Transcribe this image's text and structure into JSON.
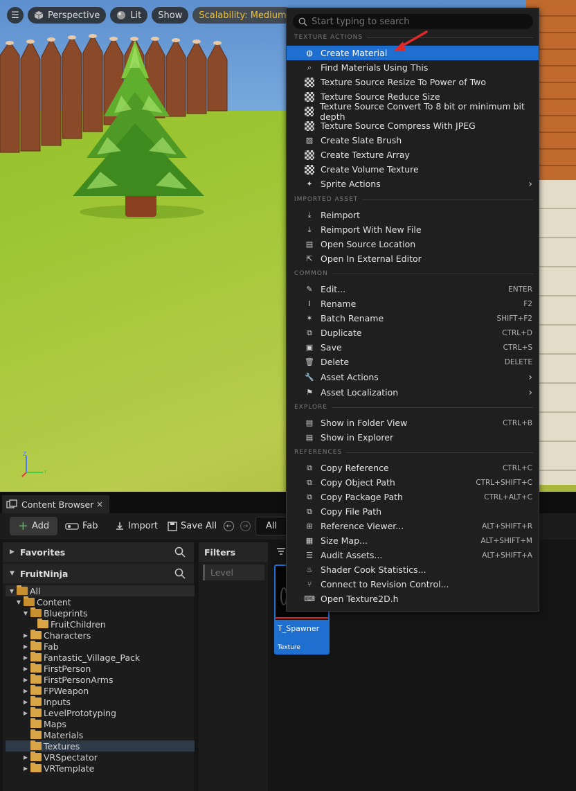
{
  "viewport": {
    "menu_icon": "hamburger-icon",
    "perspective_label": "Perspective",
    "lit_label": "Lit",
    "show_label": "Show",
    "scalability_label": "Scalability: Medium",
    "axis_labels": {
      "z": "Z",
      "x": "X",
      "y": "Y"
    }
  },
  "context_menu": {
    "search_placeholder": "Start typing to search",
    "sections": {
      "texture_actions": "TEXTURE ACTIONS",
      "imported_asset": "IMPORTED ASSET",
      "common": "COMMON",
      "explore": "EXPLORE",
      "references": "REFERENCES"
    },
    "items": [
      {
        "label": "Create Material",
        "icon": "material-icon",
        "highlighted": true
      },
      {
        "label": "Find Materials Using This",
        "icon": "find-icon"
      },
      {
        "label": "Texture Source Resize To Power of Two",
        "icon": "checker-icon"
      },
      {
        "label": "Texture Source Reduce Size",
        "icon": "checker-icon"
      },
      {
        "label": "Texture Source Convert To 8 bit or minimum bit depth",
        "icon": "checker-icon"
      },
      {
        "label": "Texture Source Compress With JPEG",
        "icon": "checker-icon"
      },
      {
        "label": "Create Slate Brush",
        "icon": "brush-icon"
      },
      {
        "label": "Create Texture Array",
        "icon": "checker-icon"
      },
      {
        "label": "Create Volume Texture",
        "icon": "checker-icon"
      },
      {
        "label": "Sprite Actions",
        "icon": "sprite-icon",
        "submenu": true
      },
      {
        "label": "Reimport",
        "icon": "reimport-icon"
      },
      {
        "label": "Reimport With New File",
        "icon": "reimport-icon"
      },
      {
        "label": "Open Source Location",
        "icon": "folder-open-icon"
      },
      {
        "label": "Open In External Editor",
        "icon": "external-icon"
      },
      {
        "label": "Edit...",
        "icon": "edit-icon",
        "shortcut": "ENTER"
      },
      {
        "label": "Rename",
        "icon": "rename-icon",
        "shortcut": "F2"
      },
      {
        "label": "Batch Rename",
        "icon": "batch-icon",
        "shortcut": "SHIFT+F2"
      },
      {
        "label": "Duplicate",
        "icon": "duplicate-icon",
        "shortcut": "CTRL+D"
      },
      {
        "label": "Save",
        "icon": "save-icon",
        "shortcut": "CTRL+S"
      },
      {
        "label": "Delete",
        "icon": "delete-icon",
        "shortcut": "DELETE"
      },
      {
        "label": "Asset Actions",
        "icon": "wrench-icon",
        "submenu": true
      },
      {
        "label": "Asset Localization",
        "icon": "flag-icon",
        "submenu": true
      },
      {
        "label": "Show in Folder View",
        "icon": "folder-search-icon",
        "shortcut": "CTRL+B"
      },
      {
        "label": "Show in Explorer",
        "icon": "folder-search-icon"
      },
      {
        "label": "Copy Reference",
        "icon": "copy-icon",
        "shortcut": "CTRL+C"
      },
      {
        "label": "Copy Object Path",
        "icon": "copy-icon",
        "shortcut": "CTRL+SHIFT+C"
      },
      {
        "label": "Copy Package Path",
        "icon": "copy-icon",
        "shortcut": "CTRL+ALT+C"
      },
      {
        "label": "Copy File Path",
        "icon": "copy-icon"
      },
      {
        "label": "Reference Viewer...",
        "icon": "reference-icon",
        "shortcut": "ALT+SHIFT+R"
      },
      {
        "label": "Size Map...",
        "icon": "sizemap-icon",
        "shortcut": "ALT+SHIFT+M"
      },
      {
        "label": "Audit Assets...",
        "icon": "audit-icon",
        "shortcut": "ALT+SHIFT+A"
      },
      {
        "label": "Shader Cook Statistics...",
        "icon": "shader-icon"
      },
      {
        "label": "Connect to Revision Control...",
        "icon": "revision-icon"
      },
      {
        "label": "Open Texture2D.h",
        "icon": "code-icon"
      }
    ]
  },
  "content_browser": {
    "tab_label": "Content Browser",
    "close_glyph": "×",
    "toolbar": {
      "add_label": "Add",
      "fab_label": "Fab",
      "import_label": "Import",
      "save_all_label": "Save All",
      "path_label": "All"
    },
    "favorites_label": "Favorites",
    "project_label": "FruitNinja",
    "filters_label": "Filters",
    "filter_level_label": "Level",
    "tree": [
      {
        "label": "All",
        "level": 0,
        "expanded": true,
        "open": true
      },
      {
        "label": "Content",
        "level": 1,
        "expanded": true,
        "open": true
      },
      {
        "label": "Blueprints",
        "level": 2,
        "expanded": true,
        "open": true
      },
      {
        "label": "FruitChildren",
        "level": 3
      },
      {
        "label": "Characters",
        "level": 2,
        "collapsed": true
      },
      {
        "label": "Fab",
        "level": 2,
        "collapsed": true
      },
      {
        "label": "Fantastic_Village_Pack",
        "level": 2,
        "collapsed": true
      },
      {
        "label": "FirstPerson",
        "level": 2,
        "collapsed": true
      },
      {
        "label": "FirstPersonArms",
        "level": 2,
        "collapsed": true
      },
      {
        "label": "FPWeapon",
        "level": 2,
        "collapsed": true
      },
      {
        "label": "Inputs",
        "level": 2,
        "collapsed": true
      },
      {
        "label": "LevelPrototyping",
        "level": 2,
        "collapsed": true
      },
      {
        "label": "Maps",
        "level": 2
      },
      {
        "label": "Materials",
        "level": 2
      },
      {
        "label": "Textures",
        "level": 2,
        "selected": true
      },
      {
        "label": "VRSpectator",
        "level": 2,
        "collapsed": true
      },
      {
        "label": "VRTemplate",
        "level": 2,
        "collapsed": true
      }
    ],
    "asset": {
      "name": "T_Spawner",
      "type": "Texture"
    }
  },
  "colors": {
    "highlight": "#1e6fd0",
    "scalability_text": "#f2c230",
    "folder": "#d9a546",
    "annotation_arrow": "#e02a2a"
  }
}
